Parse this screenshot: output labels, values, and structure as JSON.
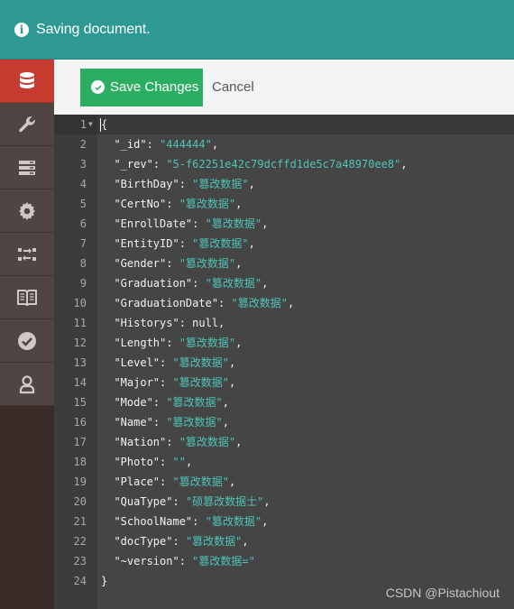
{
  "notification": {
    "message": "Saving document.",
    "icon": "info-icon",
    "color": "#2e9893"
  },
  "sidebar": {
    "items": [
      {
        "name": "database",
        "icon": "database-icon",
        "active": true
      },
      {
        "name": "tools",
        "icon": "wrench-icon"
      },
      {
        "name": "server",
        "icon": "server-icon"
      },
      {
        "name": "settings",
        "icon": "gear-icon"
      },
      {
        "name": "replication",
        "icon": "replicate-icon"
      },
      {
        "name": "docs",
        "icon": "book-icon"
      },
      {
        "name": "verify",
        "icon": "check-circle-icon"
      },
      {
        "name": "user",
        "icon": "user-icon"
      }
    ]
  },
  "toolbar": {
    "save_label": "Save Changes",
    "cancel_label": "Cancel"
  },
  "editor": {
    "lines": [
      "{",
      "  \"_id\": \"444444\",",
      "  \"_rev\": \"5-f62251e42c79dcffd1de5c7a48970ee8\",",
      "  \"BirthDay\": \"篡改数据\",",
      "  \"CertNo\": \"篡改数据\",",
      "  \"EnrollDate\": \"篡改数据\",",
      "  \"EntityID\": \"篡改数据\",",
      "  \"Gender\": \"篡改数据\",",
      "  \"Graduation\": \"篡改数据\",",
      "  \"GraduationDate\": \"篡改数据\",",
      "  \"Historys\": null,",
      "  \"Length\": \"篡改数据\",",
      "  \"Level\": \"篡改数据\",",
      "  \"Major\": \"篡改数据\",",
      "  \"Mode\": \"篡改数据\",",
      "  \"Name\": \"篡改数据\",",
      "  \"Nation\": \"篡改数据\",",
      "  \"Photo\": \"\",",
      "  \"Place\": \"篡改数据\",",
      "  \"QuaType\": \"硕篡改数据士\",",
      "  \"SchoolName\": \"篡改数据\",",
      "  \"docType\": \"篡改数据\",",
      "  \"~version\": \"篡改数据=\"",
      "}"
    ]
  },
  "watermark": "CSDN @Pistachiout"
}
